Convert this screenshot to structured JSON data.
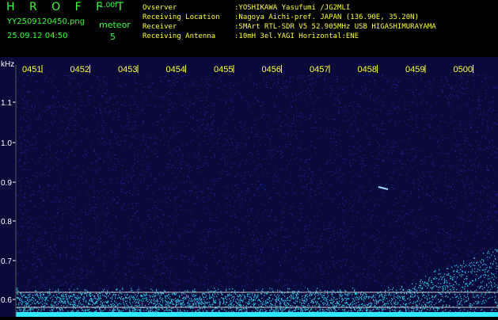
{
  "header": {
    "brand": "H R O F F T",
    "version": "1.00f",
    "filename": "YY2509120450.png",
    "datetime": "25.09.12 04:50",
    "meteor_label": "meteor",
    "meteor_count": "5"
  },
  "info": [
    {
      "label": "Ovserver",
      "value": ":YOSHIKAWA Yasufumi /JG2MLI"
    },
    {
      "label": "Receiving Location",
      "value": ":Nagoya Aichi-pref. JAPAN (136.90E, 35.20N)"
    },
    {
      "label": "Receiver",
      "value": ":SMArt RTL-SDR V5 52.905MHz USB HIGASHIMURAYAMA"
    },
    {
      "label": "Receiving Antenna",
      "value": ":10mH 3el.YAGI Horizontal:ENE"
    }
  ],
  "plot": {
    "y_unit": "kHz",
    "y_ticks": [
      "1.1",
      "1.0",
      "0.9",
      "0.8",
      "0.7",
      "0.6"
    ],
    "time_labels": [
      "0451",
      "0452",
      "0453",
      "0454",
      "0455",
      "0456",
      "0457",
      "0458",
      "0459",
      "0500"
    ],
    "colors": {
      "background": "#0a0a3a",
      "noise": "#2d3cff",
      "band": "#30e8ff",
      "axis_text": "#ffffff",
      "time_text": "#ffff3a"
    }
  }
}
